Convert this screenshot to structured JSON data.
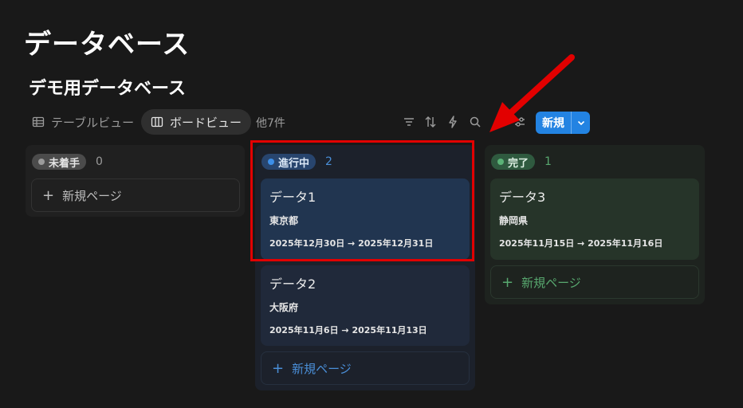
{
  "page_title": "データベース",
  "database_title": "デモ用データベース",
  "views": {
    "table_label": "テーブルビュー",
    "board_label": "ボードビュー",
    "more_label": "他7件"
  },
  "toolbar": {
    "icons": [
      "filter-icon",
      "sort-icon",
      "lightning-icon",
      "search-icon",
      "settings-icon"
    ],
    "new_label": "新規"
  },
  "columns": {
    "todo": {
      "label": "未着手",
      "count": "0",
      "add_label": "新規ページ",
      "color": "#5a5a5a"
    },
    "in_progress": {
      "label": "進行中",
      "count": "2",
      "add_label": "新規ページ",
      "color": "#2e4e7a",
      "cards": [
        {
          "title": "データ1",
          "location": "東京都",
          "date": "2025年12月30日 → 2025年12月31日"
        },
        {
          "title": "データ2",
          "location": "大阪府",
          "date": "2025年11月6日 → 2025年11月13日"
        }
      ]
    },
    "done": {
      "label": "完了",
      "count": "1",
      "add_label": "新規ページ",
      "color": "#2f5a3f",
      "cards": [
        {
          "title": "データ3",
          "location": "静岡県",
          "date": "2025年11月15日 → 2025年11月16日"
        }
      ]
    }
  },
  "annotation_colors": {
    "highlight": "#e20000",
    "arrow": "#e20000"
  }
}
